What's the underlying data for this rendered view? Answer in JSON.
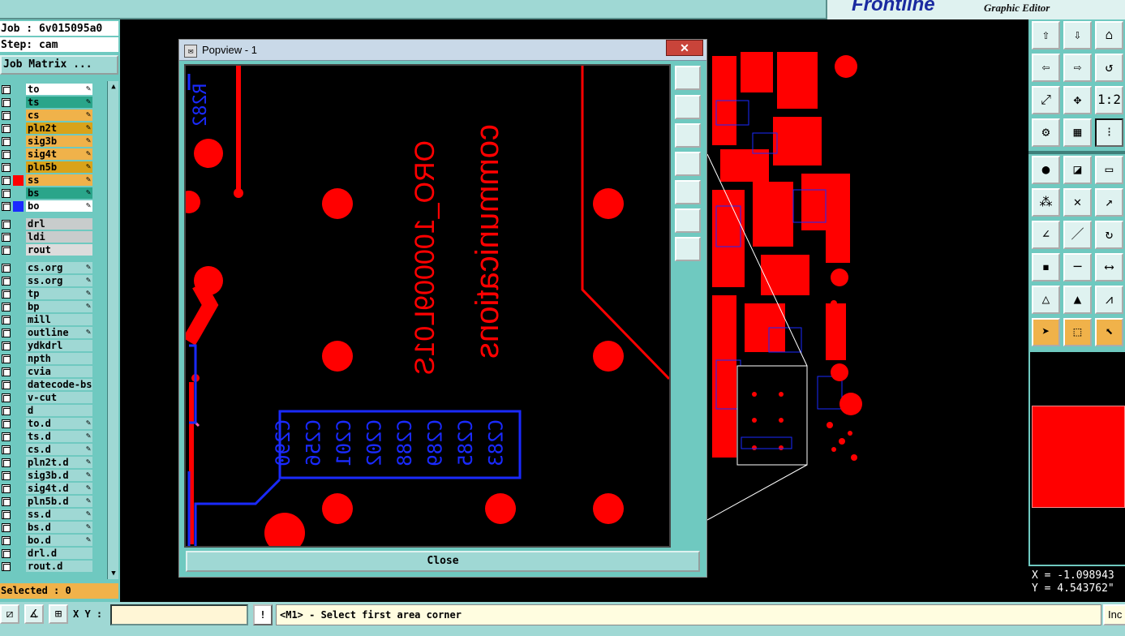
{
  "brand": {
    "logo": "Frontline",
    "subtitle": "Graphic Editor"
  },
  "job": {
    "job_line": "Job : 6v015095a0",
    "step_line": "Step: cam",
    "matrix_button": "Job Matrix ..."
  },
  "layers": [
    {
      "name": "to",
      "color": "#ffffff",
      "pen": true
    },
    {
      "name": "ts",
      "color": "#2aa58a",
      "pen": true
    },
    {
      "name": "cs",
      "color": "#f0b24a",
      "pen": true
    },
    {
      "name": "pln2t",
      "color": "#d9a31a",
      "pen": true
    },
    {
      "name": "sig3b",
      "color": "#f0b24a",
      "pen": true
    },
    {
      "name": "sig4t",
      "color": "#f0b24a",
      "pen": true
    },
    {
      "name": "pln5b",
      "color": "#d9a31a",
      "pen": true
    },
    {
      "name": "ss",
      "color": "#f0b24a",
      "pen": true,
      "swatch": "#ff0000"
    },
    {
      "name": "bs",
      "color": "#2aa58a",
      "pen": true
    },
    {
      "name": "bo",
      "color": "#ffffff",
      "pen": true,
      "swatch": "#1a2aff"
    },
    {
      "gap": true
    },
    {
      "name": "drl",
      "color": "#c8cccc"
    },
    {
      "name": "ldi",
      "color": "#c8cccc"
    },
    {
      "name": "rout",
      "color": "#dcdcdc"
    },
    {
      "gap": true
    },
    {
      "name": "cs.org",
      "color": "#9fd8d4",
      "pen": true
    },
    {
      "name": "ss.org",
      "color": "#9fd8d4",
      "pen": true
    },
    {
      "name": "tp",
      "color": "#9fd8d4",
      "pen": true
    },
    {
      "name": "bp",
      "color": "#9fd8d4",
      "pen": true
    },
    {
      "name": "mill",
      "color": "#9fd8d4"
    },
    {
      "name": "outline",
      "color": "#9fd8d4",
      "pen": true
    },
    {
      "name": "ydkdrl",
      "color": "#9fd8d4"
    },
    {
      "name": "npth",
      "color": "#9fd8d4"
    },
    {
      "name": "cvia",
      "color": "#9fd8d4"
    },
    {
      "name": "datecode-bs",
      "color": "#9fd8d4"
    },
    {
      "name": "v-cut",
      "color": "#9fd8d4"
    },
    {
      "name": "d",
      "color": "#9fd8d4"
    },
    {
      "name": "to.d",
      "color": "#9fd8d4",
      "pen": true
    },
    {
      "name": "ts.d",
      "color": "#9fd8d4",
      "pen": true
    },
    {
      "name": "cs.d",
      "color": "#9fd8d4",
      "pen": true
    },
    {
      "name": "pln2t.d",
      "color": "#9fd8d4",
      "pen": true
    },
    {
      "name": "sig3b.d",
      "color": "#9fd8d4",
      "pen": true
    },
    {
      "name": "sig4t.d",
      "color": "#9fd8d4",
      "pen": true
    },
    {
      "name": "pln5b.d",
      "color": "#9fd8d4",
      "pen": true
    },
    {
      "name": "ss.d",
      "color": "#9fd8d4",
      "pen": true
    },
    {
      "name": "bs.d",
      "color": "#9fd8d4",
      "pen": true
    },
    {
      "name": "bo.d",
      "color": "#9fd8d4",
      "pen": true
    },
    {
      "name": "drl.d",
      "color": "#9fd8d4"
    },
    {
      "name": "rout.d",
      "color": "#9fd8d4"
    }
  ],
  "selected": "Selected : 0",
  "bottom": {
    "xy_label": "X Y :",
    "xy_value": "",
    "message": "<M1> - Select first area corner",
    "inc_label": "Inc"
  },
  "coords": {
    "x": "X = -1.098943",
    "y": "Y = 4.543762\""
  },
  "popup": {
    "title": "Popview - 1",
    "close_x": "✕",
    "close_button": "Close",
    "silk_text_1": "communications",
    "silk_text_2": "ORO_100009L01S",
    "ref_top": "R282",
    "ref_labels": [
      "C290",
      "C256",
      "C201",
      "C202",
      "C288",
      "C289",
      "C285",
      "C283"
    ]
  },
  "colors": {
    "copper": "#ff0000",
    "silk": "#1a2aff",
    "panel": "#6fc9c0"
  }
}
